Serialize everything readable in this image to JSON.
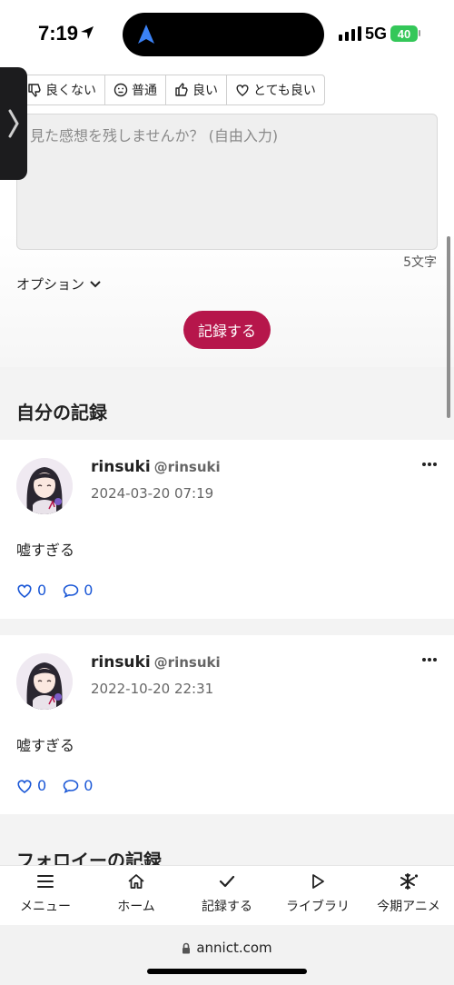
{
  "status_bar": {
    "time": "7:19",
    "network": "5G",
    "battery": "40"
  },
  "form": {
    "ratings": [
      {
        "label": "良くない",
        "icon": "thumbs-down-icon"
      },
      {
        "label": "普通",
        "icon": "neutral-face-icon"
      },
      {
        "label": "良い",
        "icon": "thumbs-up-icon"
      },
      {
        "label": "とても良い",
        "icon": "heart-icon"
      }
    ],
    "comment_placeholder": "見た感想を残しませんか？ (自由入力)",
    "char_count": "5文字",
    "options_label": "オプション",
    "submit_label": "記録する"
  },
  "my_records": {
    "heading": "自分の記録",
    "items": [
      {
        "username": "rinsuki",
        "handle": "@rinsuki",
        "timestamp": "2024-03-20 07:19",
        "comment": "嘘すぎる",
        "likes": "0",
        "comments": "0"
      },
      {
        "username": "rinsuki",
        "handle": "@rinsuki",
        "timestamp": "2022-10-20 22:31",
        "comment": "嘘すぎる",
        "likes": "0",
        "comments": "0"
      }
    ]
  },
  "followee_records": {
    "heading": "フォロイーの記録"
  },
  "tab_bar": {
    "items": [
      {
        "label": "メニュー",
        "icon": "menu-icon"
      },
      {
        "label": "ホーム",
        "icon": "home-icon"
      },
      {
        "label": "記録する",
        "icon": "checkmark-icon"
      },
      {
        "label": "ライブラリ",
        "icon": "play-icon"
      },
      {
        "label": "今期アニメ",
        "icon": "snowflake-icon"
      }
    ]
  },
  "browser": {
    "url": "annict.com"
  },
  "colors": {
    "accent": "#b6164b",
    "link": "#1a57d6"
  }
}
